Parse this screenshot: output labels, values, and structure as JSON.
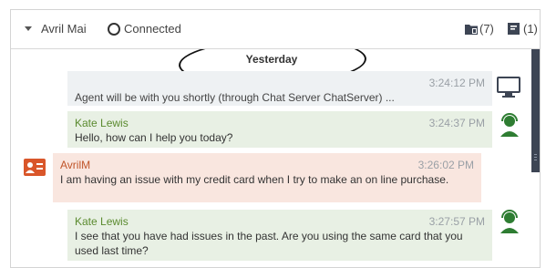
{
  "header": {
    "contact_name": "Avril Mai",
    "connection_status": "Connected",
    "cases_count": "(7)",
    "notes_count": "(1)"
  },
  "transcript": {
    "day_divider": "Yesterday",
    "messages": [
      {
        "sender": "",
        "time": "3:24:12 PM",
        "text": "Agent will be with you shortly (through Chat Server ChatServer) ...",
        "type": "system",
        "icon": "monitor-icon"
      },
      {
        "sender": "Kate Lewis",
        "time": "3:24:37 PM",
        "text": "Hello, how can I help you today?",
        "type": "agent",
        "icon": "agent-headset-icon"
      },
      {
        "sender": "AvrilM",
        "time": "3:26:02 PM",
        "text": "I am having an issue with my credit card when I try to make an on line purchase.",
        "type": "customer",
        "icon": "contact-card-icon"
      },
      {
        "sender": "Kate Lewis",
        "time": "3:27:57 PM",
        "text": "I see that you have had issues in the past. Are you using the same card that you used last time?",
        "type": "agent",
        "icon": "agent-headset-icon"
      }
    ]
  },
  "colors": {
    "agent_name": "#5a8a2e",
    "customer_name": "#c0552a",
    "customer_icon": "#d9562a",
    "agent_icon": "#2e7d32",
    "scrollbar": "#3d4554"
  }
}
